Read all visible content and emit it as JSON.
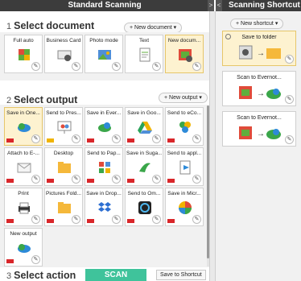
{
  "window": {
    "left_title": "Standard Scanning",
    "right_title": "Scanning Shortcut",
    "collapse_left": ">",
    "collapse_right": "<"
  },
  "select_document": {
    "number": "1",
    "title": "Select document",
    "new_button": "+ New document ▾",
    "items": [
      {
        "label": "Full auto",
        "icon": "auto-scan-icon"
      },
      {
        "label": "Business Card",
        "icon": "business-card-icon"
      },
      {
        "label": "Photo mode",
        "icon": "photo-icon"
      },
      {
        "label": "Text",
        "icon": "text-document-icon"
      },
      {
        "label": "New docum...",
        "icon": "new-document-icon"
      }
    ]
  },
  "select_output": {
    "number": "2",
    "title": "Select output",
    "new_button": "+ New output ▾",
    "items": [
      {
        "label": "Save in One...",
        "icon": "onedrive-icon"
      },
      {
        "label": "Send to Pres...",
        "icon": "presentation-icon"
      },
      {
        "label": "Save in Ever...",
        "icon": "evernote-icon"
      },
      {
        "label": "Save in Goo...",
        "icon": "google-drive-icon"
      },
      {
        "label": "Send to eCo...",
        "icon": "ecopy-icon"
      },
      {
        "label": "Attach to E-...",
        "icon": "email-icon"
      },
      {
        "label": "Desktop",
        "icon": "desktop-folder-icon"
      },
      {
        "label": "Send to Pap...",
        "icon": "paperport-icon"
      },
      {
        "label": "Save in Suga...",
        "icon": "sugarsync-icon"
      },
      {
        "label": "Send to appl...",
        "icon": "application-icon"
      },
      {
        "label": "Print",
        "icon": "printer-icon"
      },
      {
        "label": "Pictures Fold...",
        "icon": "pictures-folder-icon"
      },
      {
        "label": "Save in Drop...",
        "icon": "dropbox-icon"
      },
      {
        "label": "Send to Om...",
        "icon": "omnipage-icon"
      },
      {
        "label": "Save in Micr...",
        "icon": "microsoft-icon"
      },
      {
        "label": "New output",
        "icon": "cloud-output-icon"
      }
    ]
  },
  "select_action": {
    "number": "3",
    "title": "Select action",
    "scan_button": "SCAN",
    "shortcut_button": "Save to Shortcut"
  },
  "shortcuts": {
    "new_button": "+ New shortcut ▾",
    "items": [
      {
        "label": "Save to folder"
      },
      {
        "label": "Scan to Evernot..."
      },
      {
        "label": "Scan to Evernot..."
      }
    ]
  },
  "colors": {
    "scan": "#3fc39b",
    "selected": "#fdf2d0",
    "pdf": "#d9262a"
  }
}
